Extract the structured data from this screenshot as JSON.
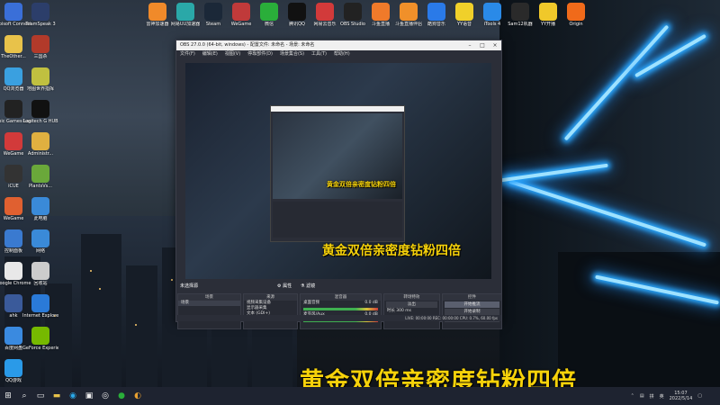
{
  "desktop_icons": [
    {
      "label": "Ubisoft Connect",
      "color": "#3a6fd8"
    },
    {
      "label": "TeamSpeak 3",
      "color": "#2c3e6a"
    },
    {
      "label": "TheOther...",
      "color": "#e8c24a"
    },
    {
      "label": "三国杀",
      "color": "#b23a2a"
    },
    {
      "label": "QQ浏览器",
      "color": "#3aa0e0"
    },
    {
      "label": "地图世界指挥",
      "color": "#c0c040"
    },
    {
      "label": "Epic Games Launcher",
      "color": "#222222"
    },
    {
      "label": "Logitech G HUB",
      "color": "#111111"
    },
    {
      "label": "WeGame",
      "color": "#d23a3a"
    },
    {
      "label": "Administr...",
      "color": "#e0b040"
    },
    {
      "label": "iCUE",
      "color": "#333333"
    },
    {
      "label": "PlantsVs...",
      "color": "#6aa83a"
    },
    {
      "label": "WeGame",
      "color": "#e06030"
    },
    {
      "label": "此电脑",
      "color": "#3a8ad8"
    },
    {
      "label": "控制面板",
      "color": "#3a7ad0"
    },
    {
      "label": "网络",
      "color": "#3a8ad8"
    },
    {
      "label": "Google Chrome",
      "color": "#e8e8e8"
    },
    {
      "label": "回收站",
      "color": "#cccccc"
    },
    {
      "label": "ahk",
      "color": "#3a5a9a"
    },
    {
      "label": "Internet Explorer",
      "color": "#2a7ad8"
    },
    {
      "label": "百度网盘",
      "color": "#3a8ae0"
    },
    {
      "label": "GeForce Experience",
      "color": "#76b900"
    },
    {
      "label": "QQ游戏",
      "color": "#2a9ae8"
    }
  ],
  "top_icons": [
    {
      "label": "雷神加速器",
      "color": "#f08a2a"
    },
    {
      "label": "网易UU加速器",
      "color": "#2aa8a8"
    },
    {
      "label": "Steam",
      "color": "#1b2838"
    },
    {
      "label": "WeGame",
      "color": "#c03a3a"
    },
    {
      "label": "微信",
      "color": "#2aae3a"
    },
    {
      "label": "腾讯QQ",
      "color": "#111111"
    },
    {
      "label": "网易云音乐",
      "color": "#d23a3a"
    },
    {
      "label": "OBS Studio",
      "color": "#222222"
    },
    {
      "label": "斗鱼直播",
      "color": "#f07a2a"
    },
    {
      "label": "斗鱼直播伴侣",
      "color": "#f0902a"
    },
    {
      "label": "酷狗音乐",
      "color": "#2a7ae8"
    },
    {
      "label": "YY语音",
      "color": "#f0d02a"
    },
    {
      "label": "iTools 4",
      "color": "#2a8ae8"
    },
    {
      "label": "Sam12机器",
      "color": "#2a2a2a"
    },
    {
      "label": "YY开播",
      "color": "#f0c82a"
    },
    {
      "label": "Origin",
      "color": "#f06a1a"
    }
  ],
  "obs": {
    "title": "OBS 27.0.0 (64-bit, windows) - 配置文件: 未命名 - 场景: 未命名",
    "menu": [
      "文件(F)",
      "编辑(E)",
      "视图(V)",
      "停靠部件(D)",
      "场景集合(S)",
      "工具(T)",
      "帮助(H)"
    ],
    "no_source": "未选择源",
    "properties_btn": "属性",
    "filters_btn": "滤镜",
    "docks": {
      "scenes": {
        "title": "场景",
        "items": [
          "场景"
        ]
      },
      "sources": {
        "title": "来源",
        "items": [
          "视频采集设备",
          "显示器采集",
          "文本 (GDI+)",
          "文本 (GDI+)",
          "文本 (GDI+)",
          "图像"
        ]
      },
      "mixer": {
        "title": "混音器",
        "tracks": [
          {
            "name": "桌面音频",
            "value": "0.0 dB"
          },
          {
            "name": "麦克风/Aux",
            "value": "0.0 dB"
          }
        ]
      },
      "transitions": {
        "title": "转场特效",
        "type": "淡出",
        "duration_label": "时长",
        "duration": "300 ms"
      },
      "controls": {
        "title": "控件",
        "buttons": [
          "开始推流",
          "开始录制",
          "启动虚拟摄像机",
          "工作室模式",
          "设置",
          "退出"
        ]
      }
    },
    "status": "LIVE: 00:00:00    REC: 00:00:00    CPU: 0.7%, 60.00 fps"
  },
  "overlay_text": "黄金双倍亲密度钻粉四倍",
  "taskbar": {
    "search_icon": "search-icon",
    "time": "15:07",
    "date": "2022/5/14",
    "lang": "拼",
    "lang2": "英"
  }
}
